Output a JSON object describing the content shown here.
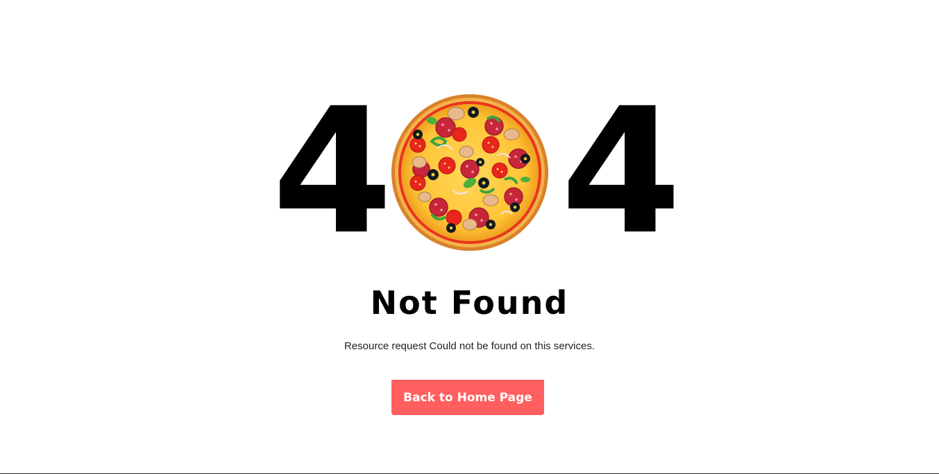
{
  "error": {
    "digit_left": "4",
    "digit_right": "4",
    "middle_icon": "pizza-icon",
    "title": "Not Found",
    "description": "Resource request Could not be found on this services.",
    "button_label": "Back to Home Page"
  },
  "colors": {
    "accent": "#ff5f5f",
    "text": "#000000",
    "background": "#ffffff"
  }
}
